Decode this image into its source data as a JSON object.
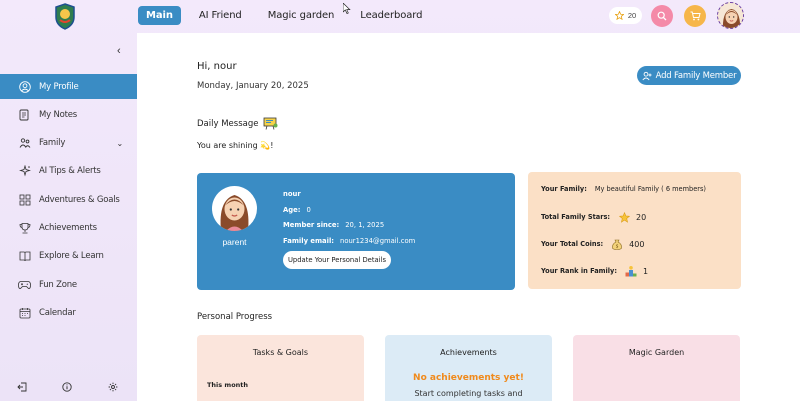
{
  "nav": {
    "items": [
      {
        "label": "Main",
        "active": true
      },
      {
        "label": "AI Friend",
        "active": false
      },
      {
        "label": "Magic garden",
        "active": false
      },
      {
        "label": "Leaderboard",
        "active": false
      }
    ],
    "stars_count": "20"
  },
  "sidebar": {
    "items": [
      {
        "label": "My Profile",
        "icon": "user-icon",
        "active": true
      },
      {
        "label": "My Notes",
        "icon": "notes-icon",
        "active": false
      },
      {
        "label": "Family",
        "icon": "family-icon",
        "active": false
      },
      {
        "label": "AI Tips & Alerts",
        "icon": "ai-icon",
        "active": false
      },
      {
        "label": "Adventures & Goals",
        "icon": "adventure-icon",
        "active": false
      },
      {
        "label": "Achievements",
        "icon": "trophy-icon",
        "active": false
      },
      {
        "label": "Explore & Learn",
        "icon": "explore-icon",
        "active": false
      },
      {
        "label": "Fun Zone",
        "icon": "gamepad-icon",
        "active": false
      },
      {
        "label": "Calendar",
        "icon": "calendar-icon",
        "active": false
      }
    ]
  },
  "main": {
    "greeting": "Hi, nour",
    "date": "Monday, January 20, 2025",
    "add_family_label": "Add Family Member",
    "daily_title": "Daily Message",
    "daily_message": "You are shining 💫!",
    "profile": {
      "name": "nour",
      "role": "parent",
      "age_label": "Age:",
      "age_value": "0",
      "member_since_label": "Member since:",
      "member_since_value": "20, 1, 2025",
      "email_label": "Family email:",
      "email_value": "nour1234@gmail.com",
      "update_label": "Update Your Personal Details"
    },
    "family": {
      "family_label": "Your Family:",
      "family_value": "My beautiful Family ( 6 members)",
      "stars_label": "Total Family Stars:",
      "stars_value": "20",
      "coins_label": "Your Total Coins:",
      "coins_value": "400",
      "rank_label": "Your Rank in Family:",
      "rank_value": "1"
    },
    "progress_title": "Personal Progress",
    "cards": {
      "tasks_title": "Tasks & Goals",
      "tasks_sub": "This month",
      "achievements_title": "Achievements",
      "achievements_empty": "No achievements yet!",
      "achievements_hint": "Start completing tasks and",
      "garden_title": "Magic Garden"
    }
  },
  "colors": {
    "accent": "#3a8cc4",
    "family_card": "#fbe0c6",
    "orange_text": "#f08a1c"
  }
}
